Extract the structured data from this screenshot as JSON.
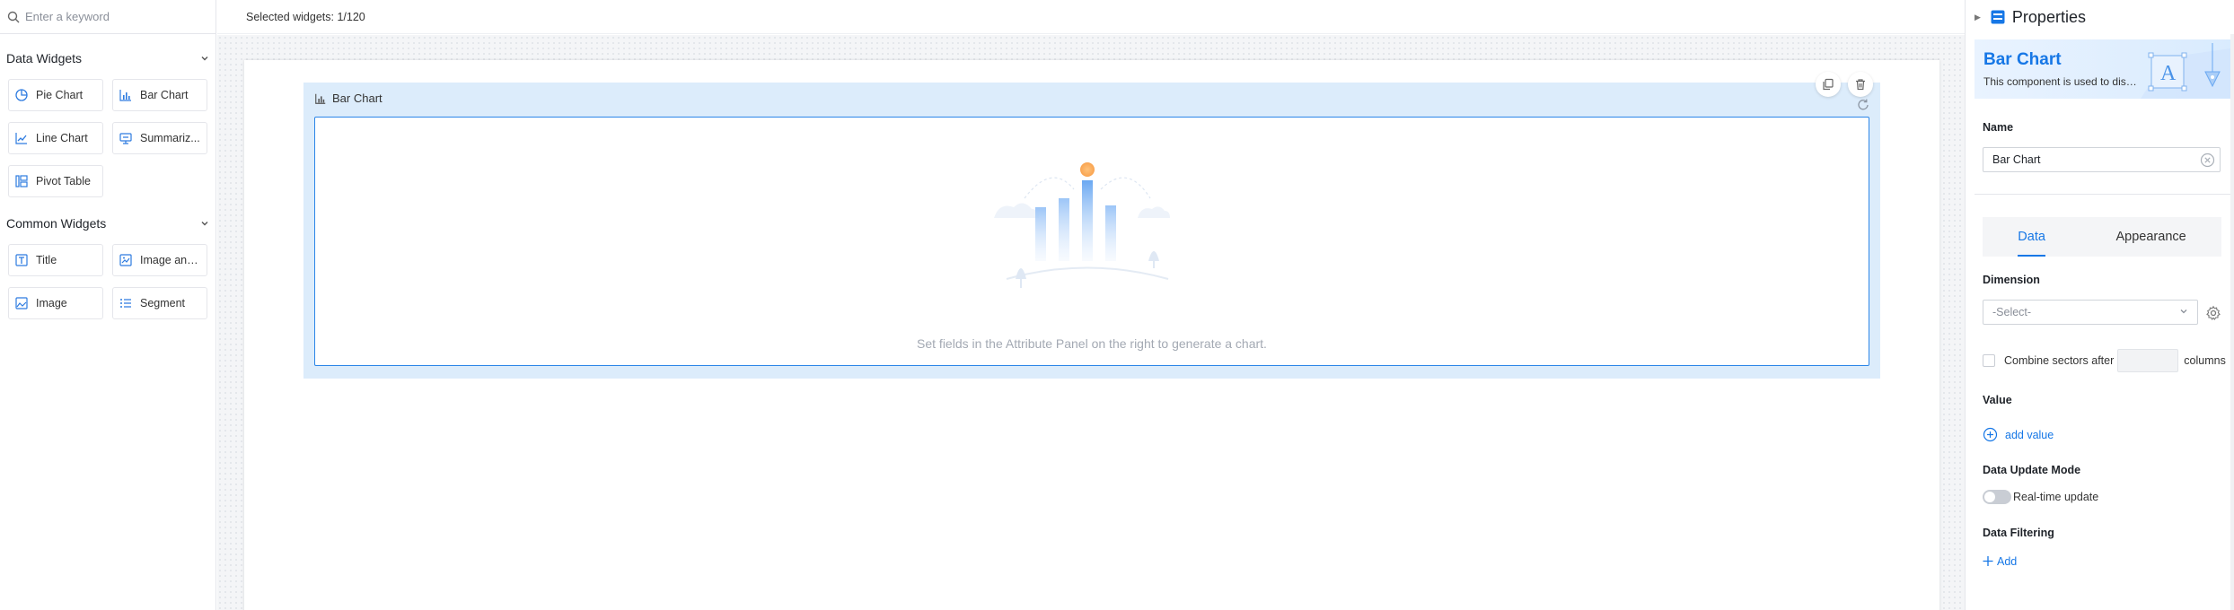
{
  "left_panel": {
    "search": {
      "placeholder": "Enter a keyword"
    },
    "groups": [
      {
        "title": "Data Widgets",
        "items": [
          {
            "label": "Pie Chart",
            "icon": "pie-chart-icon"
          },
          {
            "label": "Bar Chart",
            "icon": "bar-chart-icon"
          },
          {
            "label": "Line Chart",
            "icon": "line-chart-icon"
          },
          {
            "label": "Summariz...",
            "icon": "summary-icon"
          },
          {
            "label": "Pivot Table",
            "icon": "pivot-table-icon"
          }
        ]
      },
      {
        "title": "Common Widgets",
        "items": [
          {
            "label": "Title",
            "icon": "title-icon"
          },
          {
            "label": "Image and...",
            "icon": "image-text-icon"
          },
          {
            "label": "Image",
            "icon": "image-icon"
          },
          {
            "label": "Segment",
            "icon": "segment-icon"
          }
        ]
      }
    ]
  },
  "topbar": {
    "selected_widgets": "Selected widgets: 1/120"
  },
  "canvas": {
    "widget": {
      "title": "Bar Chart",
      "empty_text": "Set fields in the Attribute Panel on the right to generate a chart."
    }
  },
  "properties": {
    "title": "Properties",
    "hero": {
      "title": "Bar Chart",
      "desc": "This component is used to display data..."
    },
    "name_label": "Name",
    "name_value": "Bar Chart",
    "tabs": [
      {
        "label": "Data",
        "active": true
      },
      {
        "label": "Appearance",
        "active": false
      }
    ],
    "dimension_label": "Dimension",
    "dimension_select": "-Select-",
    "combine_prefix": "Combine sectors after",
    "combine_suffix": "columns",
    "value_label": "Value",
    "add_value": "add value",
    "update_mode_label": "Data Update Mode",
    "realtime_label": "Real-time update",
    "filtering_label": "Data Filtering",
    "add_filter": "Add",
    "accent_color": "#1677e6"
  }
}
